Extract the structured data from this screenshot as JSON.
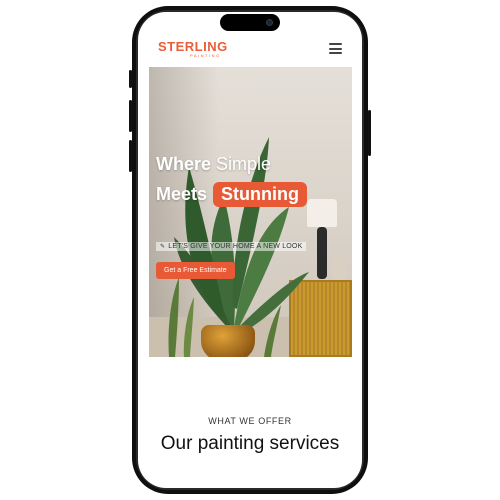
{
  "header": {
    "logo_text": "STERLING",
    "logo_subtext": "PAINTING",
    "menu_icon": "hamburger-menu-icon"
  },
  "hero": {
    "title_word1": "Where",
    "title_word2": "Simple",
    "title_line2_word": "Meets",
    "title_highlight": "Stunning",
    "tagline": "LET'S GIVE YOUR HOME A NEW LOOK",
    "tagline_icon": "paint-brush-icon",
    "cta_label": "Get a Free Estimate"
  },
  "services": {
    "eyebrow": "WHAT WE OFFER",
    "title": "Our painting services"
  },
  "colors": {
    "accent": "#e85a36",
    "logo": "#ea5d3a"
  }
}
